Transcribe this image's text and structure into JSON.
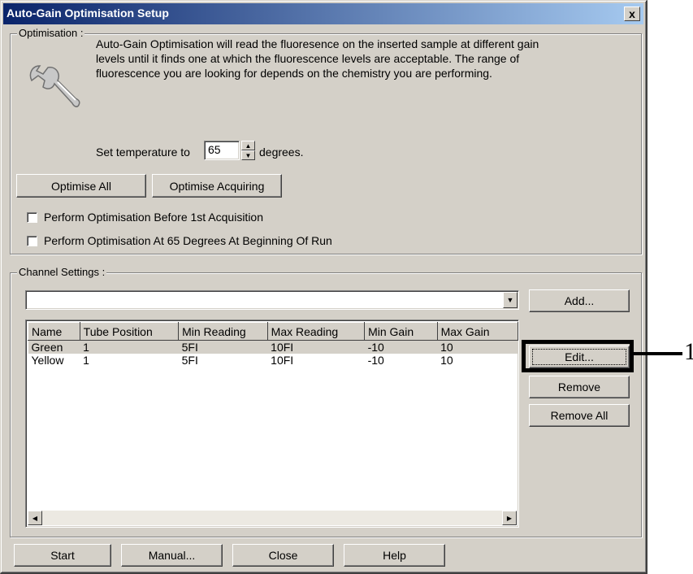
{
  "window": {
    "title": "Auto-Gain Optimisation Setup",
    "close_label": "x"
  },
  "optimisation": {
    "group_label": "Optimisation :",
    "description": "Auto-Gain Optimisation will read the fluoresence on the inserted sample at different gain levels until it finds one at which the fluorescence levels are acceptable. The range of fluorescence you are looking for depends on the chemistry you are performing.",
    "temp_prefix": "Set temperature to",
    "temp_value": "65",
    "temp_suffix": "degrees.",
    "optimise_all_label": "Optimise All",
    "optimise_acquiring_label": "Optimise Acquiring",
    "check_before_label": "Perform Optimisation Before 1st Acquisition",
    "check_at65_label": "Perform Optimisation At 65 Degrees At Beginning Of Run"
  },
  "channel": {
    "group_label": "Channel Settings :",
    "dropdown_value": "",
    "columns": [
      "Name",
      "Tube Position",
      "Min Reading",
      "Max Reading",
      "Min Gain",
      "Max Gain"
    ],
    "rows": [
      [
        "Green",
        "1",
        "5FI",
        "10FI",
        "-10",
        "10"
      ],
      [
        "Yellow",
        "1",
        "5FI",
        "10FI",
        "-10",
        "10"
      ]
    ],
    "add_label": "Add...",
    "edit_label": "Edit...",
    "remove_label": "Remove",
    "remove_all_label": "Remove All"
  },
  "footer": {
    "start_label": "Start",
    "manual_label": "Manual...",
    "close_label": "Close",
    "help_label": "Help"
  },
  "annotation": {
    "number": "1"
  }
}
